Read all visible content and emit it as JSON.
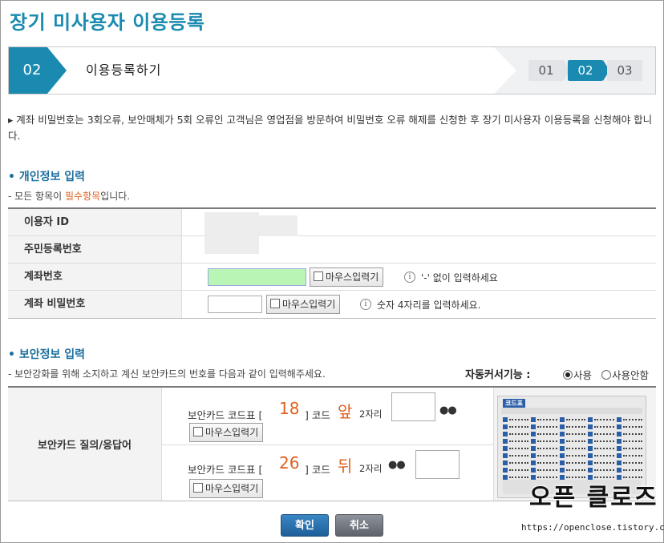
{
  "page_title": "장기 미사용자 이용등록",
  "steps": {
    "current_number": "02",
    "current_label": "이용등록하기",
    "items": [
      "01",
      "02",
      "03"
    ],
    "active_index": 1
  },
  "notice": "계좌 비밀번호는 3회오류, 보안매체가 5회 오류인 고객님은 영업점을 방문하여 비밀번호 오류 해제를 신청한 후 장기 미사용자 이용등록을 신청해야 합니다.",
  "personal": {
    "title": "개인정보 입력",
    "subtitle_prefix": "- 모든 항목이 ",
    "subtitle_required": "필수항목",
    "subtitle_suffix": "입니다.",
    "rows": {
      "user_id_label": "이용자 ID",
      "rrn_label": "주민등록번호",
      "account_label": "계좌번호",
      "account_mouse_btn": "마우스입력기",
      "account_hint": "'-' 없이 입력하세요",
      "password_label": "계좌 비밀번호",
      "password_mouse_btn": "마우스입력기",
      "password_hint": "숫자 4자리를 입력하세요."
    }
  },
  "security": {
    "title": "보안정보 입력",
    "subtitle": "- 보안강화를 위해 소지하고 계신 보안카드의 번호를 다음과 같이 입력해주세요.",
    "auto_cursor_label": "자동커서기능 :",
    "radio_use": "사용",
    "radio_no_use": "사용안함",
    "radio_selected": "사용",
    "row_label": "보안카드 질의/응답어",
    "q1": {
      "prefix": "보안카드 코드표 [",
      "number": "18",
      "mid": "] 코드",
      "position": "앞",
      "digits": "2자리",
      "mask": "●●",
      "mouse_btn": "마우스입력기"
    },
    "q2": {
      "prefix": "보안카드 코드표 [",
      "number": "26",
      "mid": "] 코드",
      "position": "뒤",
      "digits": "2자리",
      "mask": "●●",
      "mouse_btn": "마우스입력기"
    },
    "card_title": "코드표"
  },
  "buttons": {
    "confirm": "확인",
    "cancel": "취소"
  },
  "watermark": {
    "text": "오픈 클로즈",
    "url": "https://openclose.tistory.com"
  },
  "colors": {
    "accent": "#1a8ab0",
    "required": "#e0601f",
    "section_title": "#1a6fa0"
  }
}
